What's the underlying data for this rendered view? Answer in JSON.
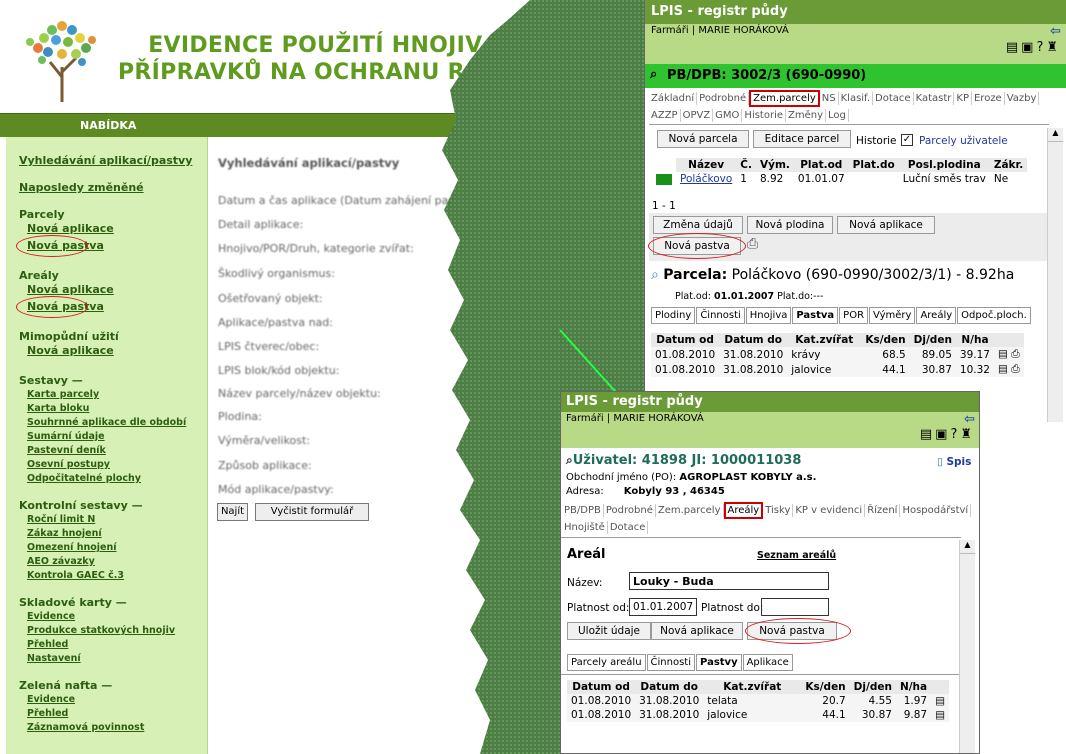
{
  "left": {
    "title_line1": "EVIDENCE POUŽITÍ HNOJIV A",
    "title_line2": "PŘÍPRAVKŮ NA OCHRANU ROSTLIN",
    "menu_label": "NABÍDKA",
    "sidebar": {
      "search": "Vyhledávání aplikací/pastvy",
      "recent": "Naposledy změněné",
      "parcely": "Parcely",
      "parcely_app": "Nová aplikace",
      "parcely_past": "Nová pastva",
      "arealy": "Areály",
      "arealy_app": "Nová aplikace",
      "arealy_past": "Nová pastva",
      "mimo": "Mimopůdní užití",
      "mimo_app": "Nová aplikace",
      "sestavy": "Sestavy —",
      "sestavy_items": [
        "Karta parcely",
        "Karta bloku",
        "Souhrnné aplikace dle období",
        "Sumární údaje",
        "Pastevní deník",
        "Osevní postupy",
        "Odpočitatelné plochy"
      ],
      "kontrolni": "Kontrolní sestavy —",
      "kontrolni_items": [
        "Roční limit N",
        "Zákaz hnojení",
        "Omezení hnojení",
        "AEO závazky",
        "Kontrola GAEC č.3"
      ],
      "sklad": "Skladové karty —",
      "sklad_items": [
        "Evidence",
        "Produkce statkových hnojiv",
        "Přehled",
        "Nastavení"
      ],
      "nafta": "Zelená nafta —",
      "nafta_items": [
        "Evidence",
        "Přehled",
        "Záznamová povinnost"
      ]
    },
    "form": {
      "title": "Vyhledávání aplikací/pastvy",
      "labels": [
        "Datum a čas aplikace (Datum zahájení pastvy):",
        "Detail aplikace:",
        "Hnojivo/POR/Druh, kategorie zvířat:",
        "Škodlivý organismus:",
        "Ošetřovaný objekt:",
        "Aplikace/pastva nad:",
        "LPIS čtverec/obec:",
        "LPIS blok/kód objektu:",
        "Název parcely/název objektu:",
        "Plodina:",
        "Výměra/velikost:",
        "Způsob aplikace:",
        "Mód aplikace/pastvy:"
      ],
      "find_btn": "Najít",
      "clear_btn": "Vyčistit formulář"
    }
  },
  "top_window": {
    "title": "LPIS - registr půdy",
    "user": "Farmáři | MARIE HORÁKOVÁ",
    "pb": "PB/DPB: 3002/3 (690-0990)",
    "tabs1": [
      "Základní",
      "Podrobné",
      "Zem.parcely",
      "NS",
      "Klasif.",
      "Dotace",
      "Katastr",
      "KP",
      "Eroze",
      "Vazby"
    ],
    "tabs2": [
      "AZZP",
      "OPVZ",
      "GMO",
      "Historie",
      "Změny",
      "Log"
    ],
    "btn_new_parcel": "Nová parcela",
    "btn_edit_parcel": "Editace parcel",
    "history_label": "Historie",
    "user_parcels": "Parcely uživatele",
    "parcel_table": {
      "headers": [
        "Název",
        "Č.",
        "Vým.",
        "Plat.od",
        "Plat.do",
        "Posl.plodina",
        "Zákr."
      ],
      "row": [
        "Poláčkovo",
        "1",
        "8.92",
        "01.01.07",
        "",
        "Luční směs trav",
        "Ne"
      ]
    },
    "pager": "1 - 1",
    "btn_change": "Změna údajů",
    "btn_new_crop": "Nová plodina",
    "btn_new_app": "Nová aplikace",
    "btn_new_past": "Nová pastva",
    "parcel_heading_bold": "Parcela:",
    "parcel_heading": "Poláčkovo (690-0990/3002/3/1) - 8.92ha",
    "plat_od_label": "Plat.od:",
    "plat_od": "01.01.2007",
    "plat_do_label": "Plat.do:---",
    "subtabs": [
      "Plodiny",
      "Činnosti",
      "Hnojiva",
      "Pastva",
      "POR",
      "Výměry",
      "Areály",
      "Odpoč.ploch."
    ],
    "past_table": {
      "headers": [
        "Datum od",
        "Datum do",
        "Kat.zvířat",
        "Ks/den",
        "Dj/den",
        "N/ha"
      ],
      "rows": [
        [
          "01.08.2010",
          "31.08.2010",
          "krávy",
          "68.5",
          "89.05",
          "39.17"
        ],
        [
          "01.08.2010",
          "31.08.2010",
          "jalovice",
          "44.1",
          "30.87",
          "10.32"
        ]
      ]
    }
  },
  "bottom_window": {
    "title": "LPIS - registr půdy",
    "user": "Farmáři | MARIE HORÁKOVÁ",
    "uzivatel": "Uživatel: 41898 JI: 1000011038",
    "spis": "Spis",
    "obch_label": "Obchodní jméno (PO):",
    "obch_value": "AGROPLAST KOBYLY a.s.",
    "adresa_label": "Adresa:",
    "adresa_value": "Kobyly 93 , 46345",
    "tabs1": [
      "PB/DPB",
      "Podrobné",
      "Zem.parcely",
      "Areály",
      "Tisky",
      "KP v evidenci",
      "Řízení",
      "Hospodářství"
    ],
    "tabs2": [
      "Hnojiště",
      "Dotace"
    ],
    "areal_title": "Areál",
    "areal_list": "Seznam areálů",
    "nazev_label": "Název:",
    "nazev_value": "Louky - Buda",
    "plat_od_label": "Platnost od:",
    "plat_od_value": "01.01.2007",
    "plat_do_label": "Platnost do:",
    "btn_save": "Uložit údaje",
    "btn_new_app": "Nová aplikace",
    "btn_new_past": "Nová pastva",
    "subtabs": [
      "Parcely areálu",
      "Činnosti",
      "Pastvy",
      "Aplikace"
    ],
    "table": {
      "headers": [
        "Datum od",
        "Datum do",
        "Kat.zvířat",
        "Ks/den",
        "Dj/den",
        "N/ha"
      ],
      "rows": [
        [
          "01.08.2010",
          "31.08.2010",
          "telata",
          "20.7",
          "4.55",
          "1.97"
        ],
        [
          "01.08.2010",
          "31.08.2010",
          "jalovice",
          "44.1",
          "30.87",
          "9.87"
        ]
      ]
    }
  }
}
